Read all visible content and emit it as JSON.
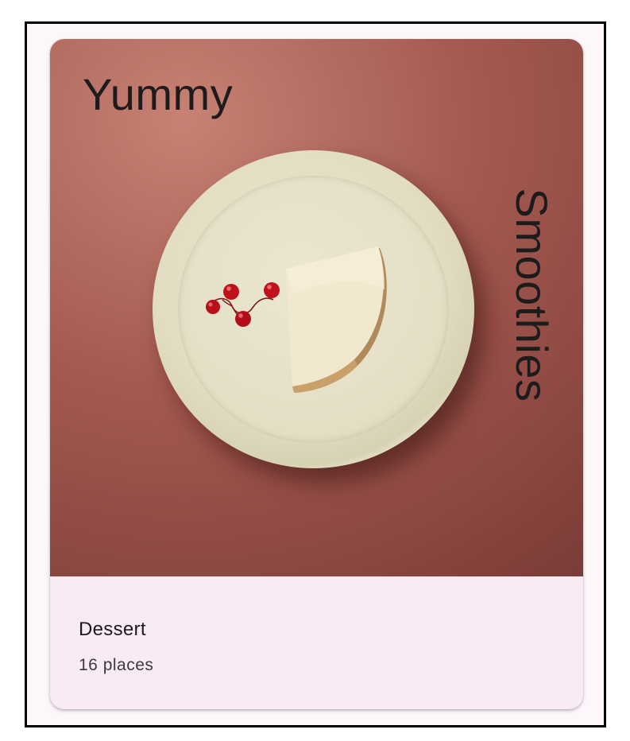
{
  "card": {
    "image_title_top": "Yummy",
    "image_title_side": "Smoothies",
    "category": "Dessert",
    "places": "16 places",
    "image_subject": "slice of cheesecake on a cream plate with red currants"
  },
  "colors": {
    "card_background": "#f9ebf4",
    "image_background": "#a55a50",
    "title_text": "#1d1b1c",
    "subtitle_text": "#3e3a3c",
    "plate": "#e3dec4",
    "berry": "#c0101c"
  }
}
